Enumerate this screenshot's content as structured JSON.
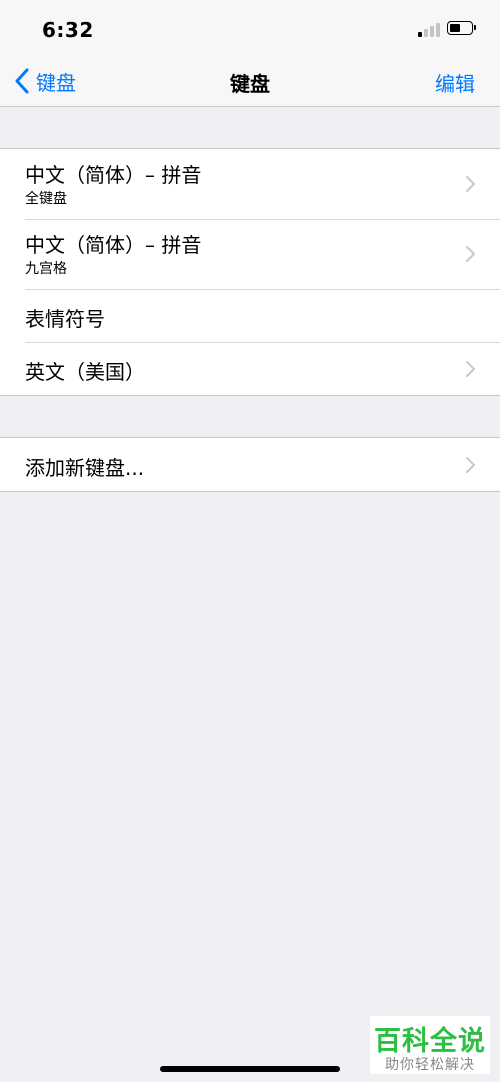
{
  "status_bar": {
    "time": "6:32",
    "signal_icon": "cellular-signal-icon",
    "battery_icon": "battery-icon",
    "battery_level": 0.5
  },
  "nav": {
    "back_label": "键盘",
    "back_icon": "chevron-left-icon",
    "title": "键盘",
    "edit_label": "编辑"
  },
  "keyboards": [
    {
      "title": "中文（简体）– 拼音",
      "subtitle": "全键盘",
      "has_chevron": true
    },
    {
      "title": "中文（简体）– 拼音",
      "subtitle": "九宫格",
      "has_chevron": true
    },
    {
      "title": "表情符号",
      "subtitle": "",
      "has_chevron": false
    },
    {
      "title": "英文（美国）",
      "subtitle": "",
      "has_chevron": true
    }
  ],
  "add_keyboard": {
    "label": "添加新键盘...",
    "icon": "chevron-right-icon"
  },
  "watermark": {
    "main": "百科全说",
    "sub": "助你轻松解决"
  },
  "colors": {
    "accent": "#007aff",
    "background": "#efeff4",
    "watermark_green": "#2dbe43"
  }
}
